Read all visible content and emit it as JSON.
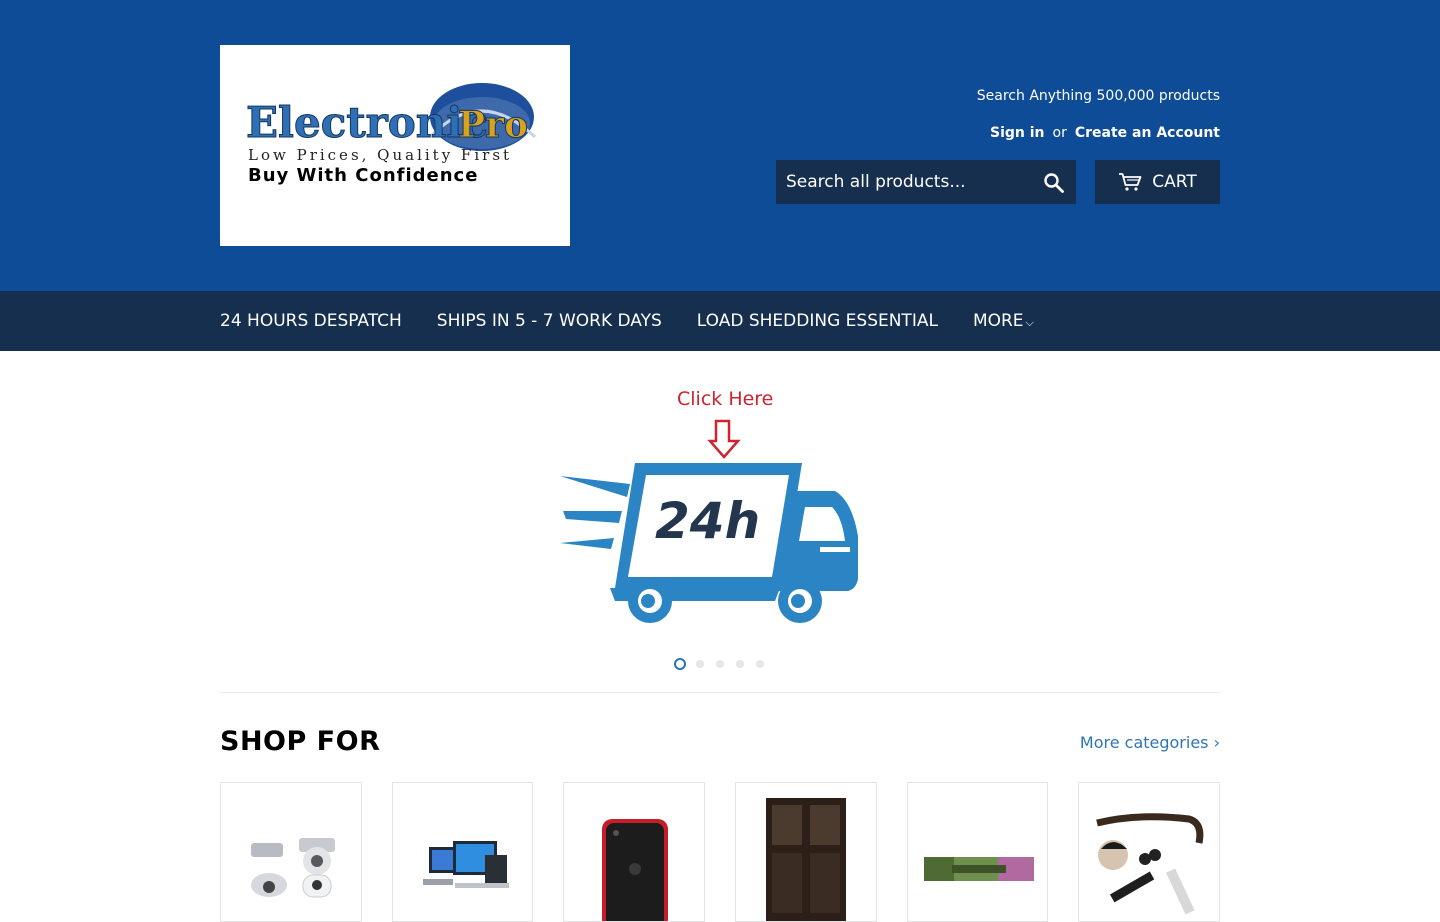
{
  "header": {
    "tagline": "Search Anything 500,000 products",
    "sign_in": "Sign in",
    "or": "or",
    "create_account": "Create an Account",
    "search_placeholder": "Search all products...",
    "cart_label": "CART"
  },
  "logo": {
    "name": "ElectronicPro",
    "line1": "Low Prices, Quality First",
    "line2": "Buy With Confidence"
  },
  "nav": {
    "items": [
      "24 HOURS DESPATCH",
      "SHIPS IN 5 - 7 WORK DAYS",
      "LOAD SHEDDING ESSENTIAL",
      "MORE"
    ]
  },
  "banner": {
    "click_text": "Click Here",
    "truck_text": "24h",
    "slide_count": 5,
    "active_slide": 1
  },
  "shop": {
    "title": "SHOP FOR",
    "more_link": "More categories ›"
  },
  "colors": {
    "header_bg": "#0f4c97",
    "nav_bg": "#172f4f",
    "link": "#2f75b5",
    "accent_red": "#d0232f",
    "truck_blue": "#2b85c4"
  }
}
